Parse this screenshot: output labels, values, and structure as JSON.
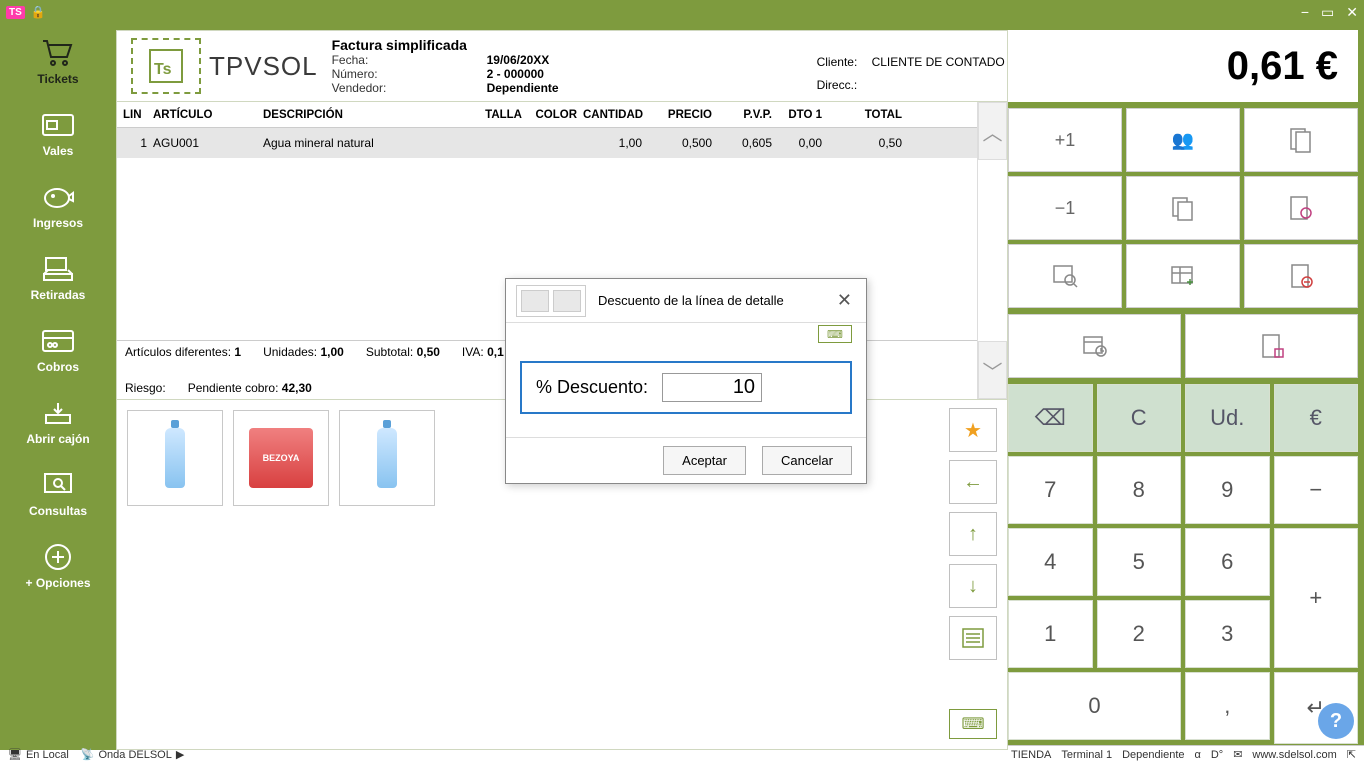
{
  "titlebar": {
    "app_badge": "TS"
  },
  "sidebar": {
    "items": [
      {
        "label": "Tickets"
      },
      {
        "label": "Vales"
      },
      {
        "label": "Ingresos"
      },
      {
        "label": "Retiradas"
      },
      {
        "label": "Cobros"
      },
      {
        "label": "Abrir cajón"
      },
      {
        "label": "Consultas"
      },
      {
        "label": "+ Opciones"
      }
    ]
  },
  "header": {
    "brand": "TPVSOL",
    "title": "Factura simplificada",
    "fecha_lbl": "Fecha:",
    "fecha": "19/06/20XX",
    "numero_lbl": "Número:",
    "numero": "2 - 000000",
    "vendedor_lbl": "Vendedor:",
    "vendedor": "Dependiente",
    "cliente_lbl": "Cliente:",
    "cliente": "CLIENTE DE CONTADO",
    "direcc_lbl": "Direcc.:",
    "direcc": ""
  },
  "table": {
    "cols": [
      "LIN",
      "ARTÍCULO",
      "DESCRIPCIÓN",
      "TALLA",
      "COLOR",
      "CANTIDAD",
      "PRECIO",
      "P.V.P.",
      "DTO 1",
      "TOTAL"
    ],
    "rows": [
      {
        "lin": "1",
        "articulo": "AGU001",
        "desc": "Agua mineral natural",
        "talla": "",
        "color": "",
        "cantidad": "1,00",
        "precio": "0,500",
        "pvp": "0,605",
        "dto": "0,00",
        "total": "0,50"
      }
    ]
  },
  "summary": {
    "art_dif_lbl": "Artículos diferentes:",
    "art_dif": "1",
    "unidades_lbl": "Unidades:",
    "unidades": "1,00",
    "subtotal_lbl": "Subtotal:",
    "subtotal": "0,50",
    "iva_lbl": "IVA:",
    "iva": "0,1",
    "riesgo_lbl": "Riesgo:",
    "pendiente_lbl": "Pendiente cobro:",
    "pendiente": "42,30"
  },
  "products": [
    {
      "name": "agua-botella"
    },
    {
      "name": "agua-pack",
      "pack_label": "BEZOYA"
    },
    {
      "name": "agua-botella-2"
    }
  ],
  "right": {
    "total": "0,61 €",
    "shortcuts_row1": [
      "+1",
      "",
      ""
    ],
    "shortcuts_row2": [
      "−1",
      "",
      ""
    ]
  },
  "keypad": {
    "top": [
      "⌫",
      "C",
      "Ud.",
      "€"
    ],
    "rows": [
      [
        "7",
        "8",
        "9",
        "−"
      ],
      [
        "4",
        "5",
        "6",
        "+"
      ],
      [
        "1",
        "2",
        "3"
      ],
      [
        "0",
        ","
      ]
    ],
    "enter": "↵"
  },
  "modal": {
    "title": "Descuento de la línea de detalle",
    "field_label": "% Descuento:",
    "value": "10",
    "accept": "Aceptar",
    "cancel": "Cancelar"
  },
  "statusbar": {
    "local": "En Local",
    "onda": "Onda DELSOL",
    "tienda": "TIENDA",
    "terminal": "Terminal 1",
    "dep": "Dependiente",
    "url": "www.sdelsol.com"
  },
  "help": "?"
}
